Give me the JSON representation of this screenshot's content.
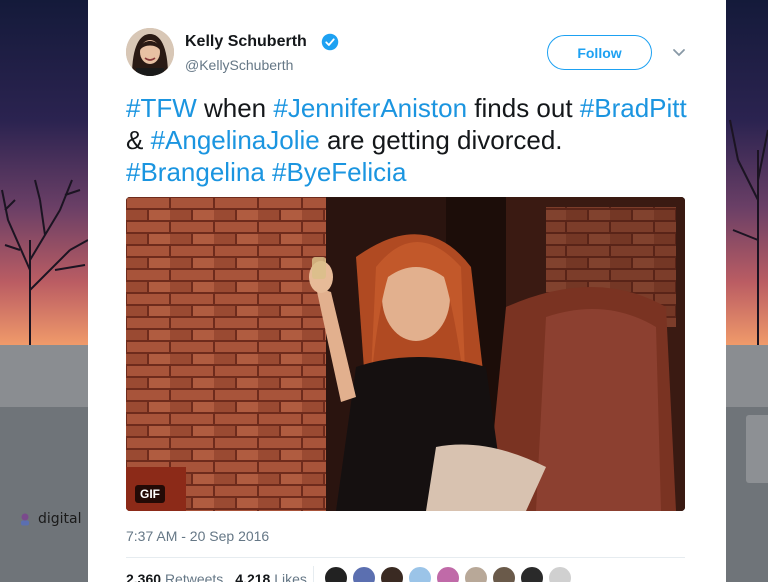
{
  "background": {
    "side_text": "digital"
  },
  "tweet": {
    "author": {
      "name": "Kelly Schuberth",
      "handle": "@KellySchuberth",
      "verified": true
    },
    "follow_label": "Follow",
    "text_segments": [
      {
        "text": "#TFW",
        "hashtag": true
      },
      {
        "text": " when ",
        "hashtag": false
      },
      {
        "text": "#JenniferAniston",
        "hashtag": true
      },
      {
        "text": " finds out ",
        "hashtag": false
      },
      {
        "text": "#BradPitt",
        "hashtag": true
      },
      {
        "text": " & ",
        "hashtag": false
      },
      {
        "text": "#AngelinaJolie",
        "hashtag": true
      },
      {
        "text": " are getting divorced. ",
        "hashtag": false
      },
      {
        "text": "#Brangelina",
        "hashtag": true
      },
      {
        "text": " ",
        "hashtag": false
      },
      {
        "text": "#ByeFelicia",
        "hashtag": true
      }
    ],
    "media_badge": "GIF",
    "timestamp": "7:37 AM - 20 Sep 2016",
    "retweets_count": "2,360",
    "retweets_label": "Retweets",
    "likes_count": "4,218",
    "likes_label": "Likes"
  },
  "colors": {
    "accent": "#1da1f2",
    "hashtag": "#1b95e0",
    "text": "#14171a",
    "muted": "#657786"
  },
  "icons": [
    "verified-badge-icon",
    "chevron-down-icon",
    "gif-badge",
    "emoji-icon"
  ]
}
